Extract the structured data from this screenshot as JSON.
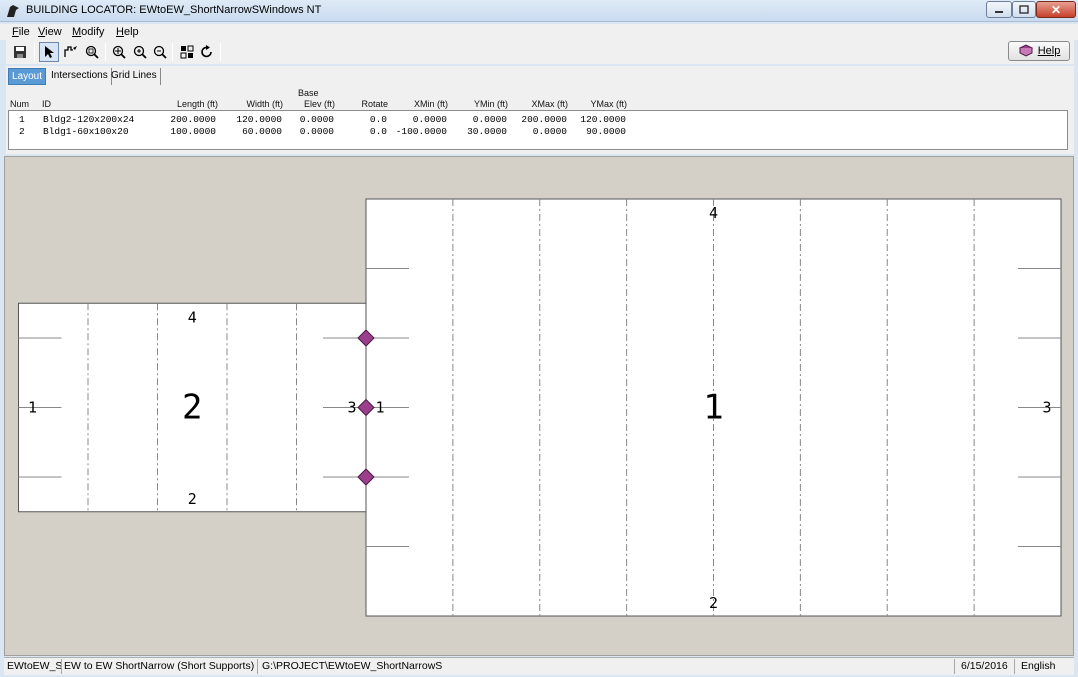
{
  "window": {
    "title": "BUILDING LOCATOR: EWtoEW_ShortNarrowS",
    "os_label": "Windows NT",
    "controls": [
      "minimize",
      "maximize",
      "close"
    ]
  },
  "menu": [
    {
      "key": "F",
      "rest": "ile"
    },
    {
      "key": "V",
      "rest": "iew"
    },
    {
      "key": "M",
      "rest": "odify"
    },
    {
      "key": "H",
      "rest": "elp"
    }
  ],
  "toolbar": {
    "icons": [
      "save-icon",
      "pointer-icon",
      "pan-icon",
      "zoom-window-icon",
      "zoom-extents-icon",
      "zoom-in-icon",
      "zoom-out-icon",
      "grid-view-icon",
      "refresh-icon"
    ],
    "help_label": "Help"
  },
  "tabs": [
    "Layout",
    "Intersections",
    "Grid Lines"
  ],
  "active_tab": "Layout",
  "table": {
    "base_label": "Base",
    "columns": [
      "Num",
      "ID",
      "Length  (ft)",
      "Width  (ft)",
      "Elev  (ft)",
      "Rotate",
      "XMin  (ft)",
      "YMin  (ft)",
      "XMax  (ft)",
      "YMax  (ft)"
    ],
    "rows": [
      [
        "1",
        "Bldg2-120x200x24",
        "200.0000",
        "120.0000",
        "0.0000",
        "0.0",
        "0.0000",
        "0.0000",
        "200.0000",
        "120.0000"
      ],
      [
        "2",
        "Bldg1-60x100x20",
        "100.0000",
        "60.0000",
        "0.0000",
        "0.0",
        "-100.0000",
        "30.0000",
        "0.0000",
        "90.0000"
      ]
    ]
  },
  "canvas": {
    "background": "#d4d0c8",
    "building_fill": "#ffffff",
    "marker_color": "#9b3f8c",
    "buildings": [
      {
        "num": "1",
        "xmin": 0,
        "ymin": 0,
        "xmax": 200,
        "ymax": 120,
        "grid_lines_x": [
          25,
          50,
          75,
          100,
          125,
          150,
          175
        ],
        "tick_y": [
          20,
          40,
          60,
          80,
          100
        ],
        "labels": {
          "center": "1",
          "top": "4",
          "bottom": "2",
          "left": "1",
          "right": "3"
        }
      },
      {
        "num": "2",
        "xmin": -100,
        "ymin": 30,
        "xmax": 0,
        "ymax": 90,
        "grid_lines_x": [
          -80,
          -60,
          -40,
          -20
        ],
        "tick_y": [
          40,
          60,
          80
        ],
        "labels": {
          "center": "2",
          "top": "4",
          "bottom": "2",
          "left": "1",
          "right": "3"
        }
      }
    ],
    "markers": [
      {
        "x": 0,
        "y": 40
      },
      {
        "x": 0,
        "y": 60
      },
      {
        "x": 0,
        "y": 80
      }
    ]
  },
  "status": {
    "short_name": "EWtoEW_Sh",
    "description": "EW to EW ShortNarrow (Short Supports)",
    "path": "G:\\PROJECT\\EWtoEW_ShortNarrowS",
    "date": "6/15/2016",
    "language": "English"
  }
}
